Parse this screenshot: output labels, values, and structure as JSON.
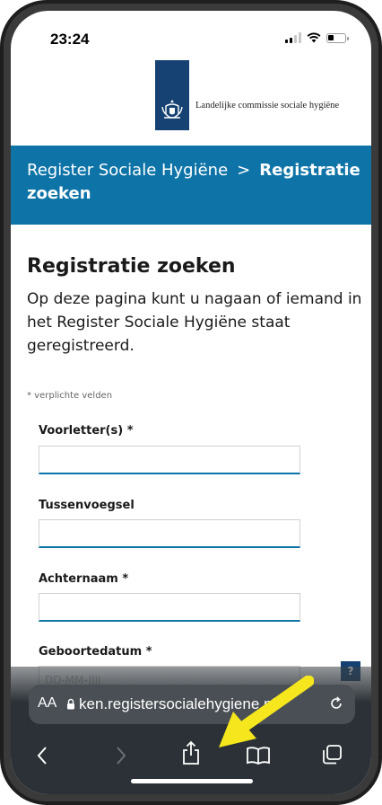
{
  "status_bar": {
    "time": "23:24",
    "icons": [
      "cellular-signal-icon",
      "wifi-icon",
      "battery-icon"
    ],
    "battery_level": 0.35
  },
  "header": {
    "org_name": "Landelijke commissie sociale hygiëne",
    "logo_color": "#154273"
  },
  "breadcrumb": {
    "parent": "Register Sociale Hygiëne",
    "separator": ">",
    "current": "Registratie zoeken",
    "background_color": "#0e74a8"
  },
  "main": {
    "title": "Registratie zoeken",
    "intro": "Op deze pagina kunt u nagaan of iemand in het Register Sociale Hygiëne staat geregistreerd.",
    "required_note": "* verplichte velden",
    "fields": [
      {
        "label": "Voorletter(s) *",
        "value": "",
        "placeholder": ""
      },
      {
        "label": "Tussenvoegsel",
        "value": "",
        "placeholder": ""
      },
      {
        "label": "Achternaam *",
        "value": "",
        "placeholder": ""
      },
      {
        "label": "Geboortedatum *",
        "value": "",
        "placeholder": "DD-MM-JJJJ"
      }
    ],
    "help_label": "?"
  },
  "browser": {
    "text_size_label": "AA",
    "url": "ken.registersocialehygiene.nl",
    "toolbar": [
      "back-icon",
      "forward-icon",
      "share-icon",
      "bookmarks-icon",
      "tabs-icon"
    ]
  },
  "annotation": {
    "arrow_color": "#f5e61e"
  }
}
